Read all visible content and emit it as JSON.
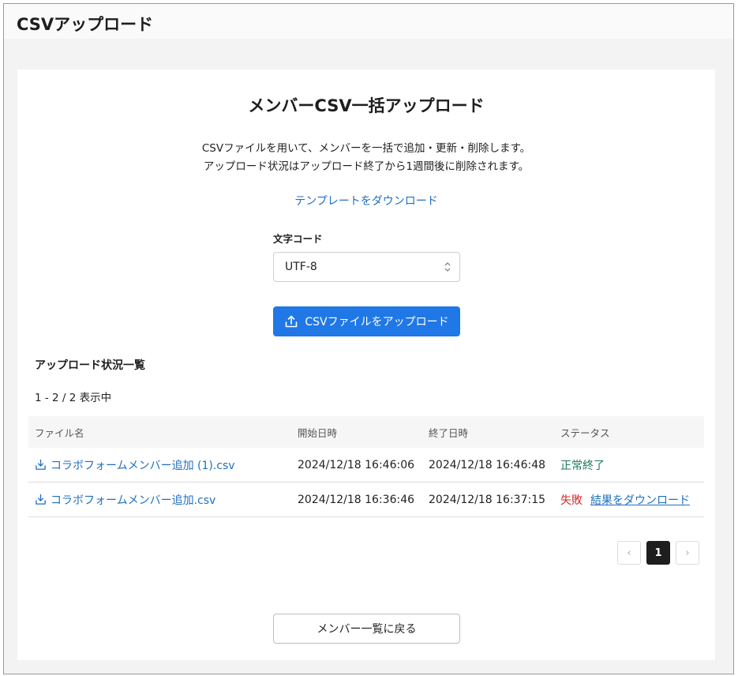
{
  "window": {
    "title": "CSVアップロード"
  },
  "card": {
    "title": "メンバーCSV一括アップロード",
    "description_line1": "CSVファイルを用いて、メンバーを一括で追加・更新・削除します。",
    "description_line2": "アップロード状況はアップロード終了から1週間後に削除されます。",
    "template_link": "テンプレートをダウンロード"
  },
  "encoding": {
    "label": "文字コード",
    "selected": "UTF-8"
  },
  "upload_button": {
    "label": "CSVファイルをアップロード",
    "icon": "upload-icon"
  },
  "status_list": {
    "title": "アップロード状況一覧",
    "count": "1 - 2 / 2 表示中",
    "columns": [
      "ファイル名",
      "開始日時",
      "終了日時",
      "ステータス"
    ],
    "rows": [
      {
        "file": "コラボフォームメンバー追加 (1).csv",
        "start": "2024/12/18 16:46:06",
        "end": "2024/12/18 16:46:48",
        "status": "正常終了",
        "result_link": ""
      },
      {
        "file": "コラボフォームメンバー追加.csv",
        "start": "2024/12/18 16:36:46",
        "end": "2024/12/18 16:37:15",
        "status": "失敗",
        "result_link": "結果をダウンロード"
      }
    ]
  },
  "pagination": {
    "prev": "‹",
    "current": "1",
    "next": "›"
  },
  "back_button": {
    "label": "メンバー一覧に戻る"
  },
  "colors": {
    "primary": "#1f78e6",
    "link": "#1f6fbf",
    "success": "#1a7a55",
    "error": "#d42a2a"
  }
}
